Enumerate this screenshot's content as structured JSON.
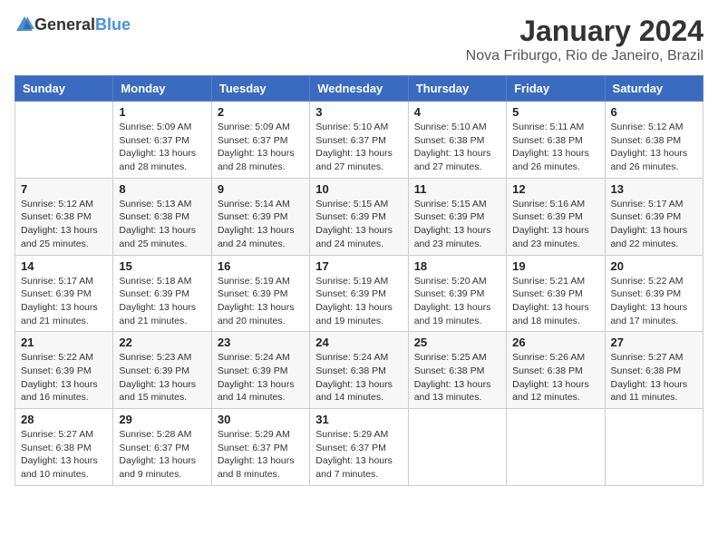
{
  "logo": {
    "general": "General",
    "blue": "Blue"
  },
  "title": "January 2024",
  "subtitle": "Nova Friburgo, Rio de Janeiro, Brazil",
  "weekdays": [
    "Sunday",
    "Monday",
    "Tuesday",
    "Wednesday",
    "Thursday",
    "Friday",
    "Saturday"
  ],
  "weeks": [
    [
      {
        "day": "",
        "info": ""
      },
      {
        "day": "1",
        "info": "Sunrise: 5:09 AM\nSunset: 6:37 PM\nDaylight: 13 hours\nand 28 minutes."
      },
      {
        "day": "2",
        "info": "Sunrise: 5:09 AM\nSunset: 6:37 PM\nDaylight: 13 hours\nand 28 minutes."
      },
      {
        "day": "3",
        "info": "Sunrise: 5:10 AM\nSunset: 6:37 PM\nDaylight: 13 hours\nand 27 minutes."
      },
      {
        "day": "4",
        "info": "Sunrise: 5:10 AM\nSunset: 6:38 PM\nDaylight: 13 hours\nand 27 minutes."
      },
      {
        "day": "5",
        "info": "Sunrise: 5:11 AM\nSunset: 6:38 PM\nDaylight: 13 hours\nand 26 minutes."
      },
      {
        "day": "6",
        "info": "Sunrise: 5:12 AM\nSunset: 6:38 PM\nDaylight: 13 hours\nand 26 minutes."
      }
    ],
    [
      {
        "day": "7",
        "info": ""
      },
      {
        "day": "8",
        "info": "Sunrise: 5:13 AM\nSunset: 6:38 PM\nDaylight: 13 hours\nand 25 minutes."
      },
      {
        "day": "9",
        "info": "Sunrise: 5:14 AM\nSunset: 6:39 PM\nDaylight: 13 hours\nand 24 minutes."
      },
      {
        "day": "10",
        "info": "Sunrise: 5:15 AM\nSunset: 6:39 PM\nDaylight: 13 hours\nand 24 minutes."
      },
      {
        "day": "11",
        "info": "Sunrise: 5:15 AM\nSunset: 6:39 PM\nDaylight: 13 hours\nand 23 minutes."
      },
      {
        "day": "12",
        "info": "Sunrise: 5:16 AM\nSunset: 6:39 PM\nDaylight: 13 hours\nand 23 minutes."
      },
      {
        "day": "13",
        "info": "Sunrise: 5:17 AM\nSunset: 6:39 PM\nDaylight: 13 hours\nand 22 minutes."
      }
    ],
    [
      {
        "day": "14",
        "info": ""
      },
      {
        "day": "15",
        "info": "Sunrise: 5:18 AM\nSunset: 6:39 PM\nDaylight: 13 hours\nand 21 minutes."
      },
      {
        "day": "16",
        "info": "Sunrise: 5:19 AM\nSunset: 6:39 PM\nDaylight: 13 hours\nand 20 minutes."
      },
      {
        "day": "17",
        "info": "Sunrise: 5:19 AM\nSunset: 6:39 PM\nDaylight: 13 hours\nand 19 minutes."
      },
      {
        "day": "18",
        "info": "Sunrise: 5:20 AM\nSunset: 6:39 PM\nDaylight: 13 hours\nand 19 minutes."
      },
      {
        "day": "19",
        "info": "Sunrise: 5:21 AM\nSunset: 6:39 PM\nDaylight: 13 hours\nand 18 minutes."
      },
      {
        "day": "20",
        "info": "Sunrise: 5:22 AM\nSunset: 6:39 PM\nDaylight: 13 hours\nand 17 minutes."
      }
    ],
    [
      {
        "day": "21",
        "info": ""
      },
      {
        "day": "22",
        "info": "Sunrise: 5:23 AM\nSunset: 6:39 PM\nDaylight: 13 hours\nand 15 minutes."
      },
      {
        "day": "23",
        "info": "Sunrise: 5:24 AM\nSunset: 6:39 PM\nDaylight: 13 hours\nand 14 minutes."
      },
      {
        "day": "24",
        "info": "Sunrise: 5:24 AM\nSunset: 6:38 PM\nDaylight: 13 hours\nand 14 minutes."
      },
      {
        "day": "25",
        "info": "Sunrise: 5:25 AM\nSunset: 6:38 PM\nDaylight: 13 hours\nand 13 minutes."
      },
      {
        "day": "26",
        "info": "Sunrise: 5:26 AM\nSunset: 6:38 PM\nDaylight: 13 hours\nand 12 minutes."
      },
      {
        "day": "27",
        "info": "Sunrise: 5:27 AM\nSunset: 6:38 PM\nDaylight: 13 hours\nand 11 minutes."
      }
    ],
    [
      {
        "day": "28",
        "info": "Sunrise: 5:27 AM\nSunset: 6:38 PM\nDaylight: 13 hours\nand 10 minutes."
      },
      {
        "day": "29",
        "info": "Sunrise: 5:28 AM\nSunset: 6:37 PM\nDaylight: 13 hours\nand 9 minutes."
      },
      {
        "day": "30",
        "info": "Sunrise: 5:29 AM\nSunset: 6:37 PM\nDaylight: 13 hours\nand 8 minutes."
      },
      {
        "day": "31",
        "info": "Sunrise: 5:29 AM\nSunset: 6:37 PM\nDaylight: 13 hours\nand 7 minutes."
      },
      {
        "day": "",
        "info": ""
      },
      {
        "day": "",
        "info": ""
      },
      {
        "day": "",
        "info": ""
      }
    ]
  ],
  "week7_sunday_info": "Sunrise: 5:12 AM\nSunset: 6:38 PM\nDaylight: 13 hours\nand 25 minutes.",
  "week14_sunday_info": "Sunrise: 5:17 AM\nSunset: 6:39 PM\nDaylight: 13 hours\nand 21 minutes.",
  "week21_sunday_info": "Sunrise: 5:22 AM\nSunset: 6:39 PM\nDaylight: 13 hours\nand 16 minutes."
}
